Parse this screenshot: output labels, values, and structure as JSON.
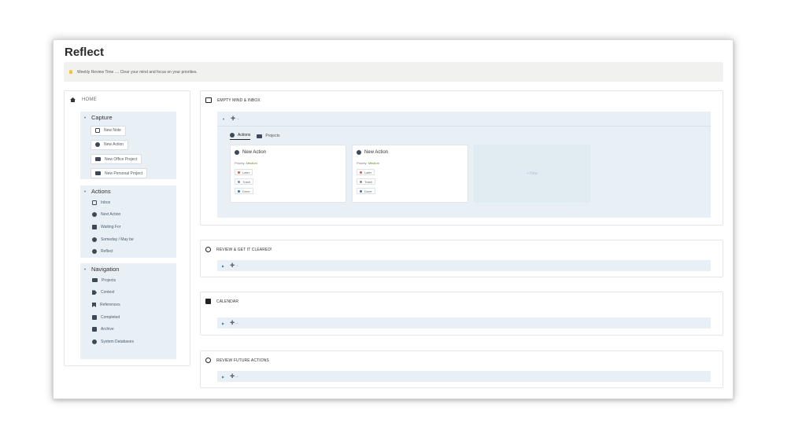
{
  "page": {
    "title": "Reflect",
    "callout": "Weekly Review Time .... Clear your mind and focus on your priorities."
  },
  "sidebar": {
    "home_label": "HOME",
    "capture": {
      "title": "Capture",
      "buttons": [
        "New Note",
        "New Action",
        "New Office Project",
        "New Personal Project"
      ]
    },
    "actions": {
      "title": "Actions",
      "items": [
        "Inbox",
        "Next Action",
        "Waiting For",
        "Someday / May be",
        "Reflect"
      ]
    },
    "navigation": {
      "title": "Navigation",
      "items": [
        "Projects",
        "Context",
        "References",
        "Completed",
        "Archive",
        "System Databases"
      ]
    }
  },
  "sections": {
    "inbox": {
      "title": "EMPTY MIND & INBOX",
      "toggle": "➕→",
      "tabs": [
        "Actions",
        "Projects"
      ],
      "cards": [
        {
          "title": "New Action",
          "priority_label": "Priority:",
          "priority": "Medium",
          "buttons": [
            "Later",
            "Trash",
            "Done"
          ]
        },
        {
          "title": "New Action",
          "priority_label": "Priority:",
          "priority": "Medium",
          "buttons": [
            "Later",
            "Trash",
            "Done"
          ]
        }
      ],
      "new_label": "+ New"
    },
    "review": {
      "title": "REVIEW & GET IT CLEARED!",
      "toggle": "➕→"
    },
    "calendar": {
      "title": "CALENDAR",
      "toggle": "➕→"
    },
    "future": {
      "title": "REVIEW FUTURE ACTIONS",
      "toggle": "➕→"
    }
  },
  "colors": {
    "panel_bg": "#e8f0f6",
    "callout_bg": "#f1f1ef",
    "priority": "#5b8a2e",
    "later": "#e05a3a",
    "trash": "#8a8a8a",
    "done": "#2f6fd0"
  }
}
